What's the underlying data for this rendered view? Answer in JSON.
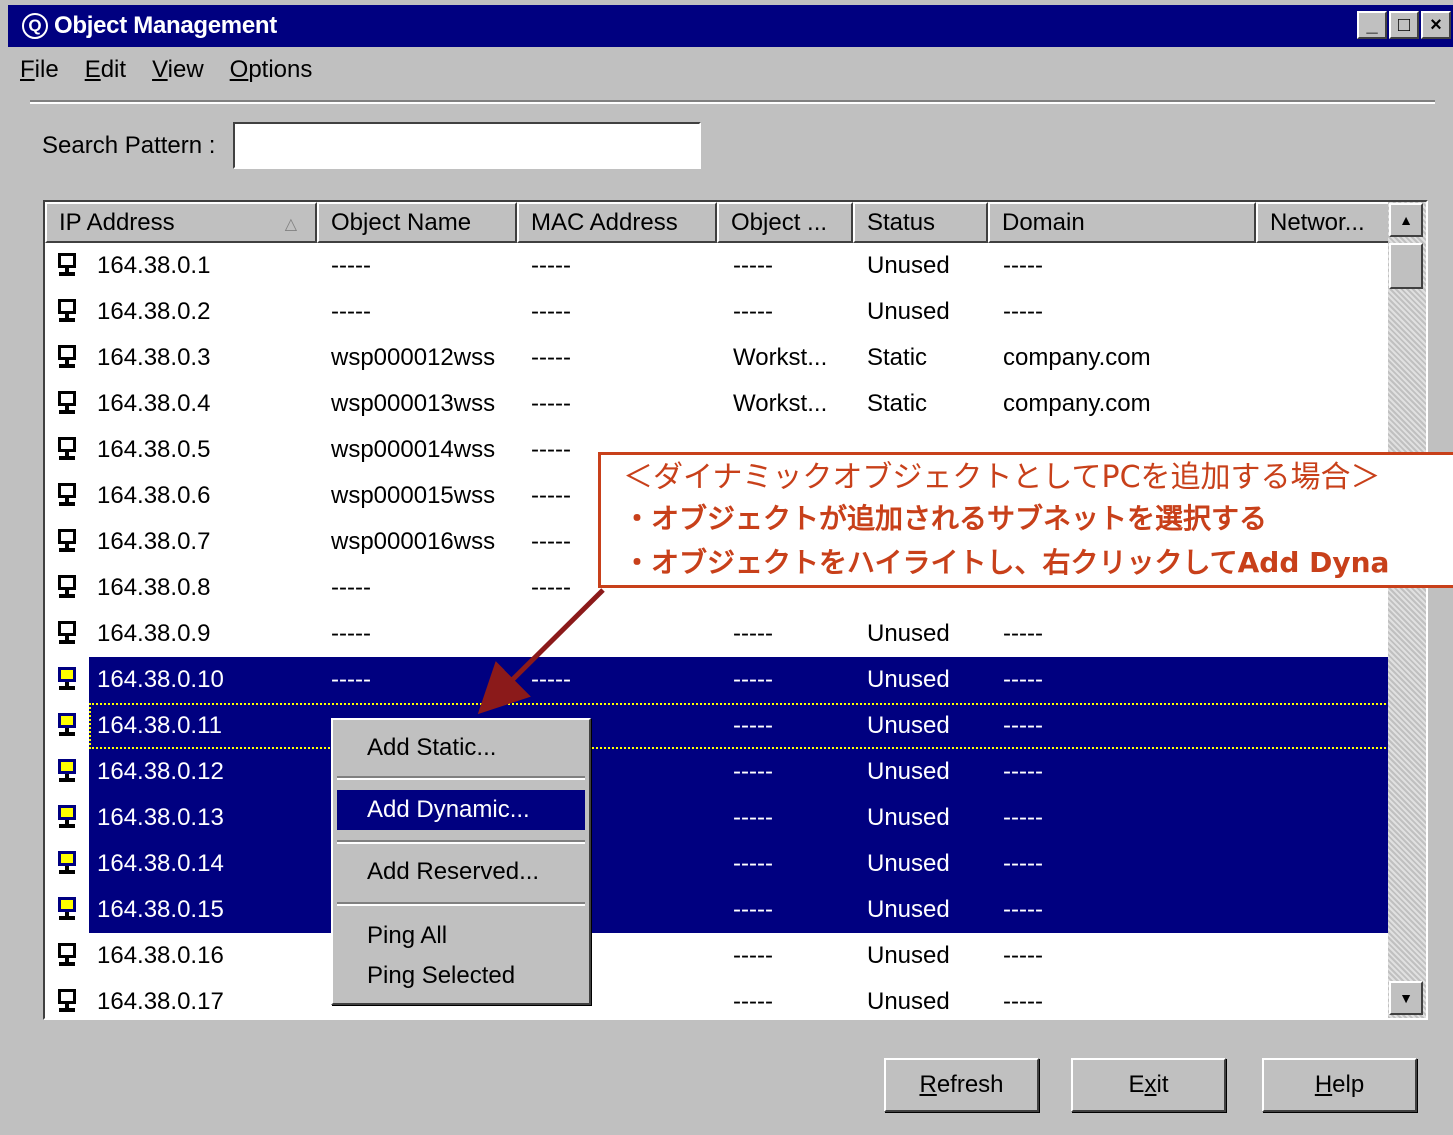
{
  "window": {
    "title": "Object Management",
    "controls": [
      "_",
      "□",
      "×"
    ]
  },
  "menu": [
    {
      "label": "File",
      "mn": "F",
      "rest": "ile"
    },
    {
      "label": "Edit",
      "mn": "E",
      "rest": "dit"
    },
    {
      "label": "View",
      "mn": "V",
      "rest": "iew"
    },
    {
      "label": "Options",
      "mn": "O",
      "rest": "ptions"
    }
  ],
  "search": {
    "label": "Search Pattern :",
    "value": ""
  },
  "columns": [
    "IP Address",
    "Object Name",
    "MAC Address",
    "Object ...",
    "Status",
    "Domain",
    "Networ..."
  ],
  "sort_indicator": "△",
  "rows": [
    {
      "ip": "164.38.0.1",
      "name": "-----",
      "mac": "-----",
      "type": "-----",
      "status": "Unused",
      "domain": "-----"
    },
    {
      "ip": "164.38.0.2",
      "name": "-----",
      "mac": "-----",
      "type": "-----",
      "status": "Unused",
      "domain": "-----"
    },
    {
      "ip": "164.38.0.3",
      "name": "wsp000012wss",
      "mac": "-----",
      "type": "Workst...",
      "status": "Static",
      "domain": "company.com"
    },
    {
      "ip": "164.38.0.4",
      "name": "wsp000013wss",
      "mac": "-----",
      "type": "Workst...",
      "status": "Static",
      "domain": "company.com"
    },
    {
      "ip": "164.38.0.5",
      "name": "wsp000014wss",
      "mac": "-----",
      "type": "",
      "status": "",
      "domain": ""
    },
    {
      "ip": "164.38.0.6",
      "name": "wsp000015wss",
      "mac": "-----",
      "type": "",
      "status": "",
      "domain": ""
    },
    {
      "ip": "164.38.0.7",
      "name": "wsp000016wss",
      "mac": "-----",
      "type": "",
      "status": "",
      "domain": ""
    },
    {
      "ip": "164.38.0.8",
      "name": "-----",
      "mac": "-----",
      "type": "",
      "status": "",
      "domain": ""
    },
    {
      "ip": "164.38.0.9",
      "name": "-----",
      "mac": "",
      "type": "-----",
      "status": "Unused",
      "domain": "-----"
    },
    {
      "ip": "164.38.0.10",
      "name": "-----",
      "mac": "-----",
      "type": "-----",
      "status": "Unused",
      "domain": "-----",
      "selected": true
    },
    {
      "ip": "164.38.0.11",
      "name": "",
      "mac": "",
      "type": "-----",
      "status": "Unused",
      "domain": "-----",
      "selected": true,
      "focused": true
    },
    {
      "ip": "164.38.0.12",
      "name": "",
      "mac": "",
      "type": "-----",
      "status": "Unused",
      "domain": "-----",
      "selected": true
    },
    {
      "ip": "164.38.0.13",
      "name": "",
      "mac": "",
      "type": "-----",
      "status": "Unused",
      "domain": "-----",
      "selected": true
    },
    {
      "ip": "164.38.0.14",
      "name": "",
      "mac": "",
      "type": "-----",
      "status": "Unused",
      "domain": "-----",
      "selected": true
    },
    {
      "ip": "164.38.0.15",
      "name": "",
      "mac": "",
      "type": "-----",
      "status": "Unused",
      "domain": "-----",
      "selected": true
    },
    {
      "ip": "164.38.0.16",
      "name": "",
      "mac": "",
      "type": "-----",
      "status": "Unused",
      "domain": "-----"
    },
    {
      "ip": "164.38.0.17",
      "name": "-----",
      "mac": "-----",
      "type": "-----",
      "status": "Unused",
      "domain": "-----"
    }
  ],
  "context_menu": [
    "Add Static...",
    "Add Dynamic...",
    "Add Reserved...",
    "Ping All",
    "Ping Selected"
  ],
  "context_highlighted": "Add Dynamic...",
  "buttons": [
    {
      "label": "Refresh",
      "mn": "R",
      "rest": "efresh"
    },
    {
      "label": "Exit",
      "pre": "E",
      "mn": "x",
      "rest": "it"
    },
    {
      "label": "Help",
      "mn": "H",
      "rest": "elp"
    }
  ],
  "callout": {
    "title": "＜ダイナミックオブジェクトとしてPCを追加する場合＞",
    "lines": [
      "・オブジェクトが追加されるサブネットを選択する",
      "・オブジェクトをハイライトし、右クリックしてAdd Dyna"
    ]
  },
  "colors": {
    "title_bg": "#000080",
    "selection": "#000080",
    "callout": "#c8401a",
    "face": "#c0c0c0"
  }
}
